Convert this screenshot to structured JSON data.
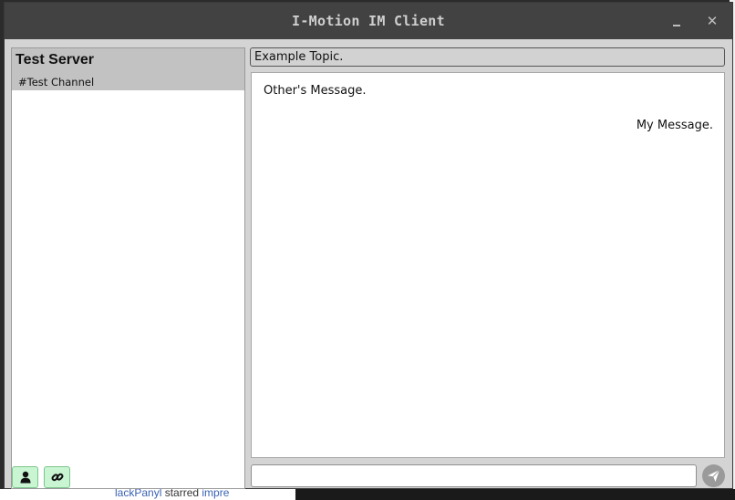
{
  "window": {
    "title": "I-Motion IM Client",
    "minimize_icon": "minimize-icon",
    "close_glyph": "✕"
  },
  "sidebar": {
    "server_name": "Test Server",
    "channels": [
      {
        "label": "#Test Channel",
        "selected": true
      }
    ],
    "buttons": [
      {
        "icon": "user-icon"
      },
      {
        "icon": "link-icon"
      }
    ],
    "button_color": "#c9f5d3"
  },
  "chat": {
    "topic": "Example Topic.",
    "messages": [
      {
        "from": "other",
        "text": "Other's Message."
      },
      {
        "from": "me",
        "text": "My Message."
      }
    ],
    "input_value": "",
    "send_icon": "send-icon"
  },
  "background": {
    "text_prefix": "lackPanyl",
    "text_middle": " starred ",
    "text_link": "impre"
  }
}
